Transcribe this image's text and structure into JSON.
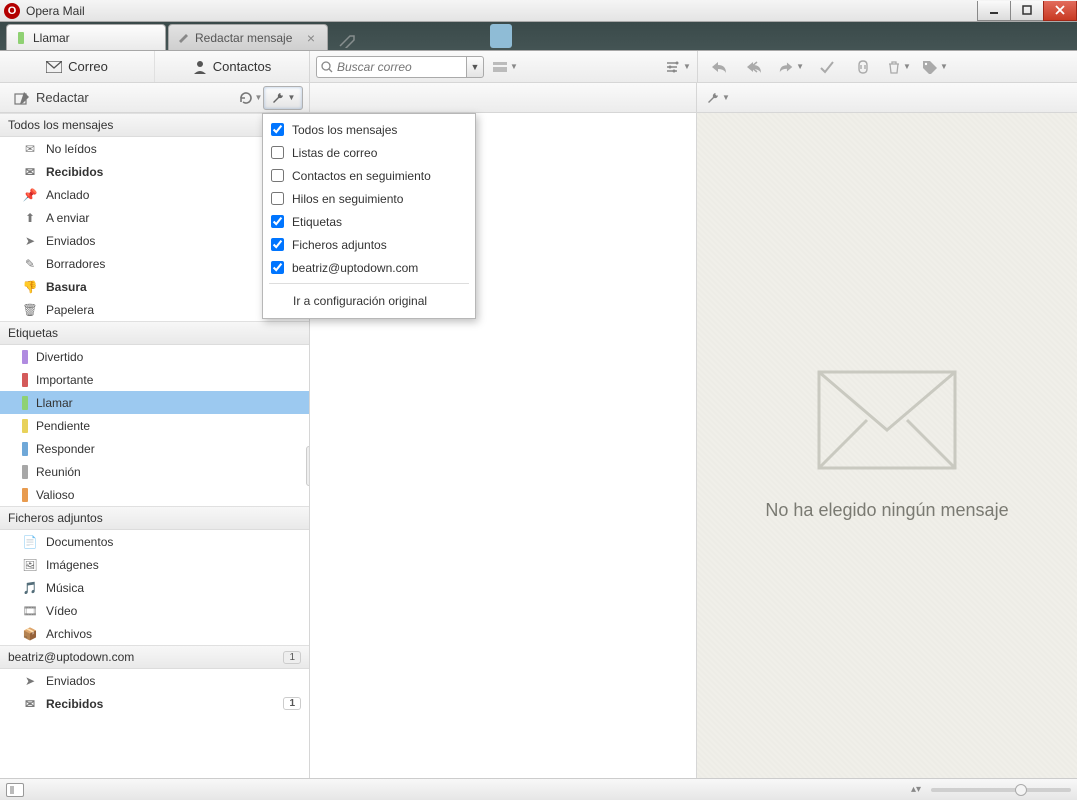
{
  "window": {
    "title": "Opera Mail"
  },
  "tabs": [
    {
      "label": "Llamar",
      "active": true
    },
    {
      "label": "Redactar mensaje",
      "active": false
    }
  ],
  "toolbar": {
    "mail_label": "Correo",
    "contacts_label": "Contactos",
    "search_placeholder": "Buscar correo"
  },
  "compose": {
    "label": "Redactar"
  },
  "sidebar": {
    "section_all": "Todos los mensajes",
    "folders": [
      {
        "label": "No leídos",
        "icon": "envelope"
      },
      {
        "label": "Recibidos",
        "icon": "inbox",
        "bold": true
      },
      {
        "label": "Anclado",
        "icon": "pin"
      },
      {
        "label": "A enviar",
        "icon": "outbox"
      },
      {
        "label": "Enviados",
        "icon": "sent"
      },
      {
        "label": "Borradores",
        "icon": "draft"
      },
      {
        "label": "Basura",
        "icon": "trash",
        "bold": true
      },
      {
        "label": "Papelera",
        "icon": "bin"
      }
    ],
    "section_tags": "Etiquetas",
    "tags": [
      {
        "label": "Divertido",
        "color": "#b08be0"
      },
      {
        "label": "Importante",
        "color": "#d45a5a"
      },
      {
        "label": "Llamar",
        "color": "#8fd173",
        "selected": true
      },
      {
        "label": "Pendiente",
        "color": "#e8d25a"
      },
      {
        "label": "Responder",
        "color": "#6fa8d8"
      },
      {
        "label": "Reunión",
        "color": "#a7a7a7"
      },
      {
        "label": "Valioso",
        "color": "#e89b4f"
      }
    ],
    "section_attach": "Ficheros adjuntos",
    "attachments": [
      {
        "label": "Documentos",
        "icon": "doc"
      },
      {
        "label": "Imágenes",
        "icon": "image"
      },
      {
        "label": "Música",
        "icon": "music"
      },
      {
        "label": "Vídeo",
        "icon": "video"
      },
      {
        "label": "Archivos",
        "icon": "archive"
      }
    ],
    "account": {
      "email": "beatriz@uptodown.com",
      "count": "1"
    },
    "account_folders": [
      {
        "label": "Enviados",
        "icon": "sent"
      },
      {
        "label": "Recibidos",
        "icon": "inbox",
        "bold": true,
        "count": "1"
      }
    ]
  },
  "dropdown": {
    "items": [
      {
        "label": "Todos los mensajes",
        "checked": true
      },
      {
        "label": "Listas de correo",
        "checked": false
      },
      {
        "label": "Contactos en seguimiento",
        "checked": false
      },
      {
        "label": "Hilos en seguimiento",
        "checked": false
      },
      {
        "label": "Etiquetas",
        "checked": true
      },
      {
        "label": "Ficheros adjuntos",
        "checked": true
      },
      {
        "label": "beatriz@uptodown.com",
        "checked": true
      }
    ],
    "reset": "Ir a configuración original"
  },
  "readpane": {
    "empty": "No ha elegido ningún mensaje"
  }
}
